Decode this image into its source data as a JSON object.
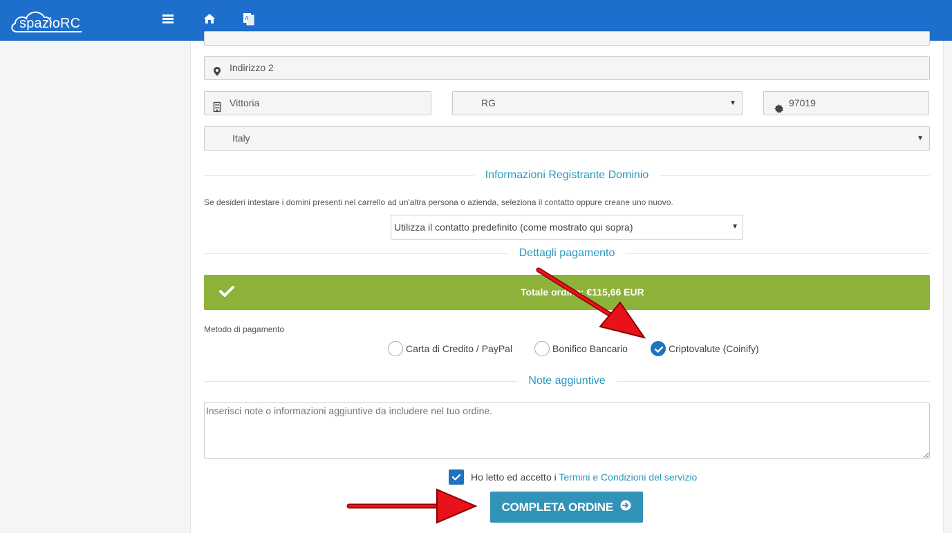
{
  "header": {
    "logo_text": "spazioRC",
    "icons": [
      "menu-icon",
      "home-icon",
      "translate-icon"
    ],
    "background": "#1e6fcc"
  },
  "address": {
    "address2_value": "Indirizzo 2",
    "city_value": "Vittoria",
    "state_value": "RG",
    "postcode_value": "97019",
    "country_value": "Italy"
  },
  "registrant": {
    "title": "Informazioni Registrante Dominio",
    "description": "Se desideri intestare i domini presenti nel carrello ad un'altra persona o azienda, seleziona il contatto oppure creane uno nuovo.",
    "contact_select_value": "Utilizza il contatto predefinito (come mostrato qui sopra)"
  },
  "payment": {
    "title": "Dettagli pagamento",
    "total_text": "Totale ordine:  €115,66 EUR",
    "total_bar_color": "#8db23a",
    "method_label": "Metodo di pagamento",
    "options": [
      {
        "label": "Carta di Credito / PayPal",
        "selected": false
      },
      {
        "label": "Bonifico Bancario",
        "selected": false
      },
      {
        "label": "Criptovalute (Coinify)",
        "selected": true
      }
    ]
  },
  "notes": {
    "title": "Note aggiuntive",
    "value": "Inserisci note o informazioni aggiuntive da includere nel tuo ordine."
  },
  "terms": {
    "checked": true,
    "text_prefix": "Ho letto ed accetto i ",
    "link_text": "Termini e Condizioni del servizio"
  },
  "submit": {
    "label": "COMPLETA ORDINE",
    "color": "#3293b8"
  },
  "accent_color": "#2a98c0"
}
